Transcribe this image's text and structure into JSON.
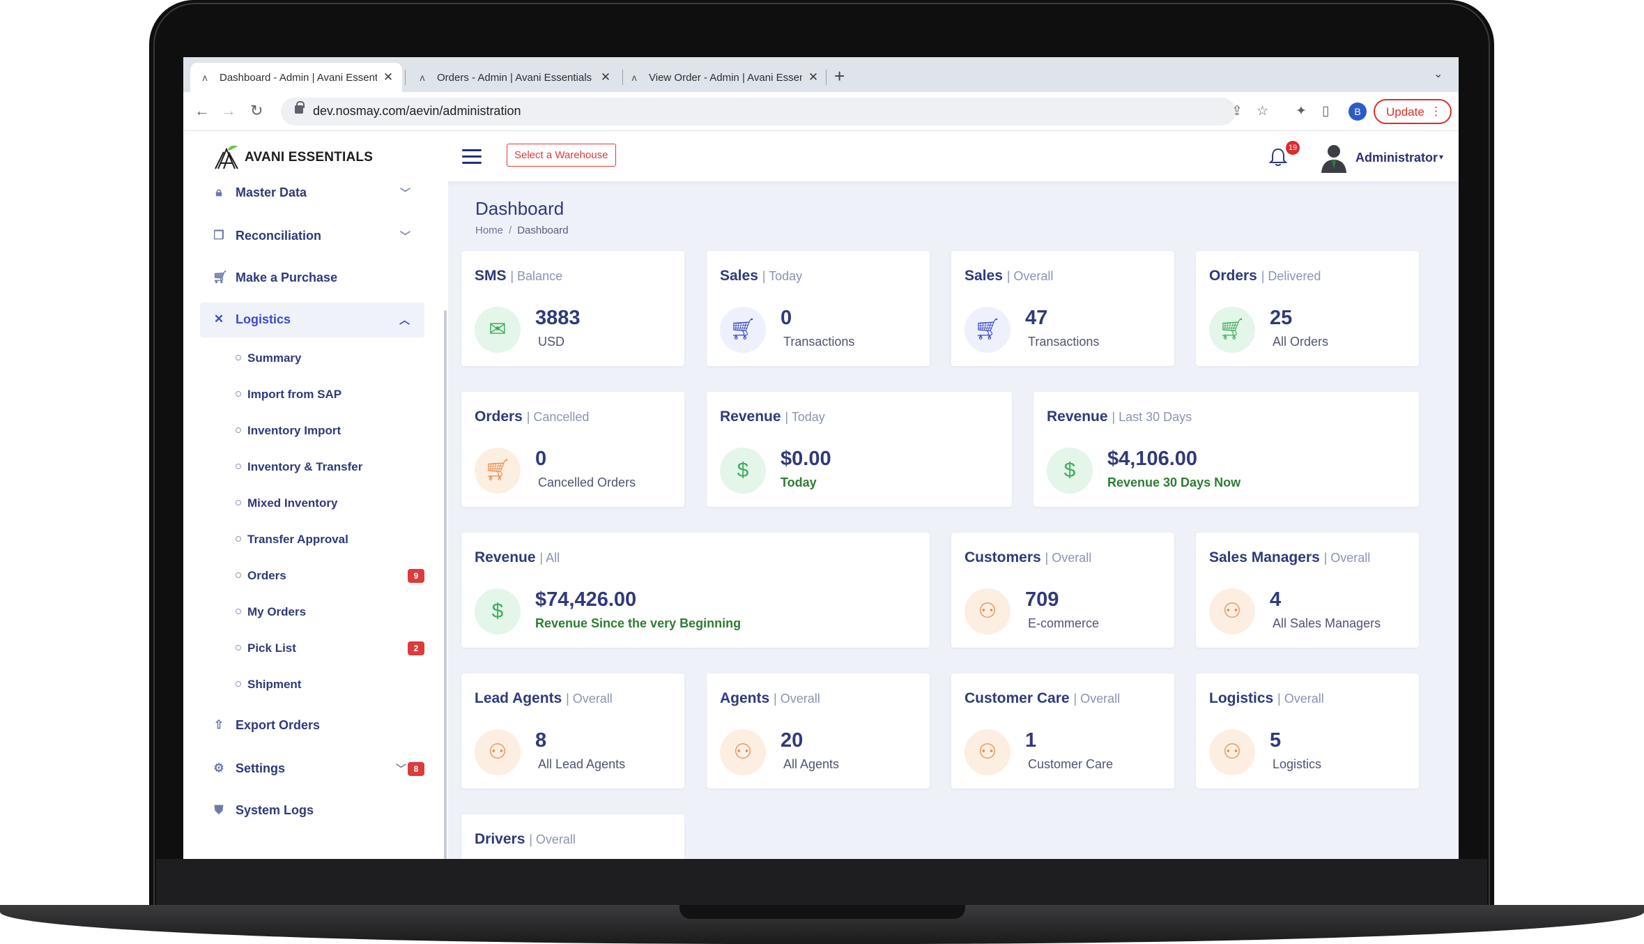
{
  "browser": {
    "tabs": [
      {
        "title": "Dashboard - Admin | Avani Essentials",
        "active": true
      },
      {
        "title": "Orders - Admin | Avani Essentials",
        "active": false
      },
      {
        "title": "View Order - Admin | Avani Essentials",
        "active": false
      }
    ],
    "url": "dev.nosmay.com/aevin/administration",
    "profile_initial": "B",
    "update_label": "Update"
  },
  "header": {
    "brand": "AVANI ESSENTIALS",
    "warehouse_button": "Select a Warehouse",
    "notification_count": "19",
    "user_name": "Administrator"
  },
  "sidebar": {
    "items": [
      {
        "label": "Master Data",
        "icon": "lock-icon",
        "chevron": "down"
      },
      {
        "label": "Reconciliation",
        "icon": "copy-icon",
        "chevron": "down"
      },
      {
        "label": "Make a Purchase",
        "icon": "cart-icon"
      },
      {
        "label": "Logistics",
        "icon": "tools-icon",
        "chevron": "up",
        "active": true
      },
      {
        "label": "Export Orders",
        "icon": "upload-icon"
      },
      {
        "label": "Settings",
        "icon": "gear-icon",
        "chevron": "down",
        "badge": "8"
      },
      {
        "label": "System Logs",
        "icon": "shield-icon"
      }
    ],
    "logistics_sub": [
      {
        "label": "Summary"
      },
      {
        "label": "Import from SAP"
      },
      {
        "label": "Inventory Import"
      },
      {
        "label": "Inventory & Transfer"
      },
      {
        "label": "Mixed Inventory"
      },
      {
        "label": "Transfer Approval"
      },
      {
        "label": "Orders",
        "badge": "9"
      },
      {
        "label": "My Orders"
      },
      {
        "label": "Pick List",
        "badge": "2"
      },
      {
        "label": "Shipment"
      }
    ]
  },
  "page": {
    "title": "Dashboard",
    "breadcrumb_home": "Home",
    "breadcrumb_current": "Dashboard"
  },
  "cards": [
    {
      "title": "SMS",
      "sub": "| Balance",
      "value": "3883",
      "label": "USD",
      "icon": "mail-icon",
      "tone": "green"
    },
    {
      "title": "Sales",
      "sub": "| Today",
      "value": "0",
      "label": "Transactions",
      "icon": "cart-icon",
      "tone": "blue"
    },
    {
      "title": "Sales",
      "sub": "| Overall",
      "value": "47",
      "label": "Transactions",
      "icon": "cart-icon",
      "tone": "blue"
    },
    {
      "title": "Orders",
      "sub": "| Delivered",
      "value": "25",
      "label": "All Orders",
      "icon": "cart-icon",
      "tone": "green"
    },
    {
      "title": "Orders",
      "sub": "| Cancelled",
      "value": "0",
      "label": "Cancelled Orders",
      "icon": "cart-icon",
      "tone": "orange"
    },
    {
      "title": "Revenue",
      "sub": "| Today",
      "value": "$0.00",
      "label": "Today",
      "icon": "dollar-icon",
      "tone": "green"
    },
    {
      "title": "Revenue",
      "sub": "| Last 30 Days",
      "value": "$4,106.00",
      "label": "Revenue 30 Days Now",
      "icon": "dollar-icon",
      "tone": "green"
    },
    {
      "title": "Revenue",
      "sub": "| All",
      "value": "$74,426.00",
      "label": "Revenue Since the very Beginning",
      "icon": "dollar-icon",
      "tone": "green"
    },
    {
      "title": "Customers",
      "sub": "| Overall",
      "value": "709",
      "label": "E-commerce",
      "icon": "users-icon",
      "tone": "orange"
    },
    {
      "title": "Sales Managers",
      "sub": "| Overall",
      "value": "4",
      "label": "All Sales Managers",
      "icon": "users-icon",
      "tone": "orange"
    },
    {
      "title": "Lead Agents",
      "sub": "| Overall",
      "value": "8",
      "label": "All Lead Agents",
      "icon": "users-icon",
      "tone": "orange"
    },
    {
      "title": "Agents",
      "sub": "| Overall",
      "value": "20",
      "label": "All Agents",
      "icon": "users-icon",
      "tone": "orange"
    },
    {
      "title": "Customer Care",
      "sub": "| Overall",
      "value": "1",
      "label": "Customer Care",
      "icon": "users-icon",
      "tone": "orange"
    },
    {
      "title": "Logistics",
      "sub": "| Overall",
      "value": "5",
      "label": "Logistics",
      "icon": "users-icon",
      "tone": "orange"
    },
    {
      "title": "Drivers",
      "sub": "| Overall"
    }
  ],
  "colors": {
    "accent": "#3a4bd0",
    "navy": "#2f3a7a",
    "danger": "#d92d2d",
    "success": "#2e7d32"
  }
}
